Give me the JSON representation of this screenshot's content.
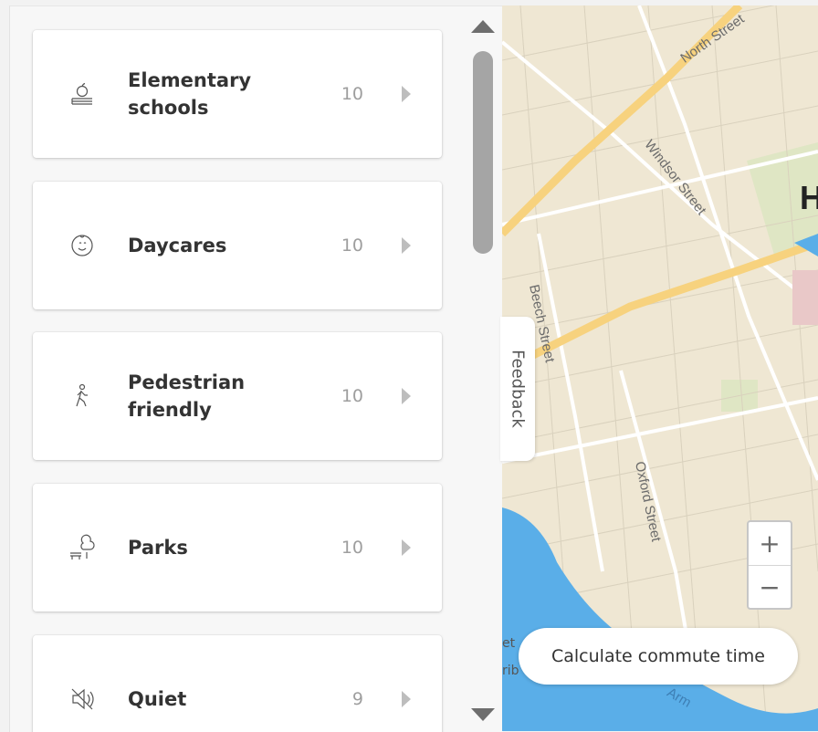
{
  "categories": [
    {
      "label": "Elementary schools",
      "count": "10",
      "icon": "apple-books-icon"
    },
    {
      "label": "Daycares",
      "count": "10",
      "icon": "baby-face-icon"
    },
    {
      "label": "Pedestrian friendly",
      "count": "10",
      "icon": "walking-person-icon"
    },
    {
      "label": "Parks",
      "count": "10",
      "icon": "park-bench-tree-icon"
    },
    {
      "label": "Quiet",
      "count": "9",
      "icon": "muted-speaker-icon"
    }
  ],
  "map": {
    "streets": {
      "north": "North Street",
      "windsor": "Windsor Street",
      "beech": "Beech Street",
      "oxford": "Oxford Street",
      "arm": "Arm"
    },
    "edge_text": "H",
    "attribution_1": "et",
    "attribution_2": "rib"
  },
  "feedback_label": "Feedback",
  "zoom": {
    "in": "+",
    "out": "−"
  },
  "commute_button": "Calculate commute time",
  "colors": {
    "water": "#5aaee8",
    "major_road": "#f7d27e",
    "land": "#efe7d3",
    "park": "#dfe6c4"
  }
}
